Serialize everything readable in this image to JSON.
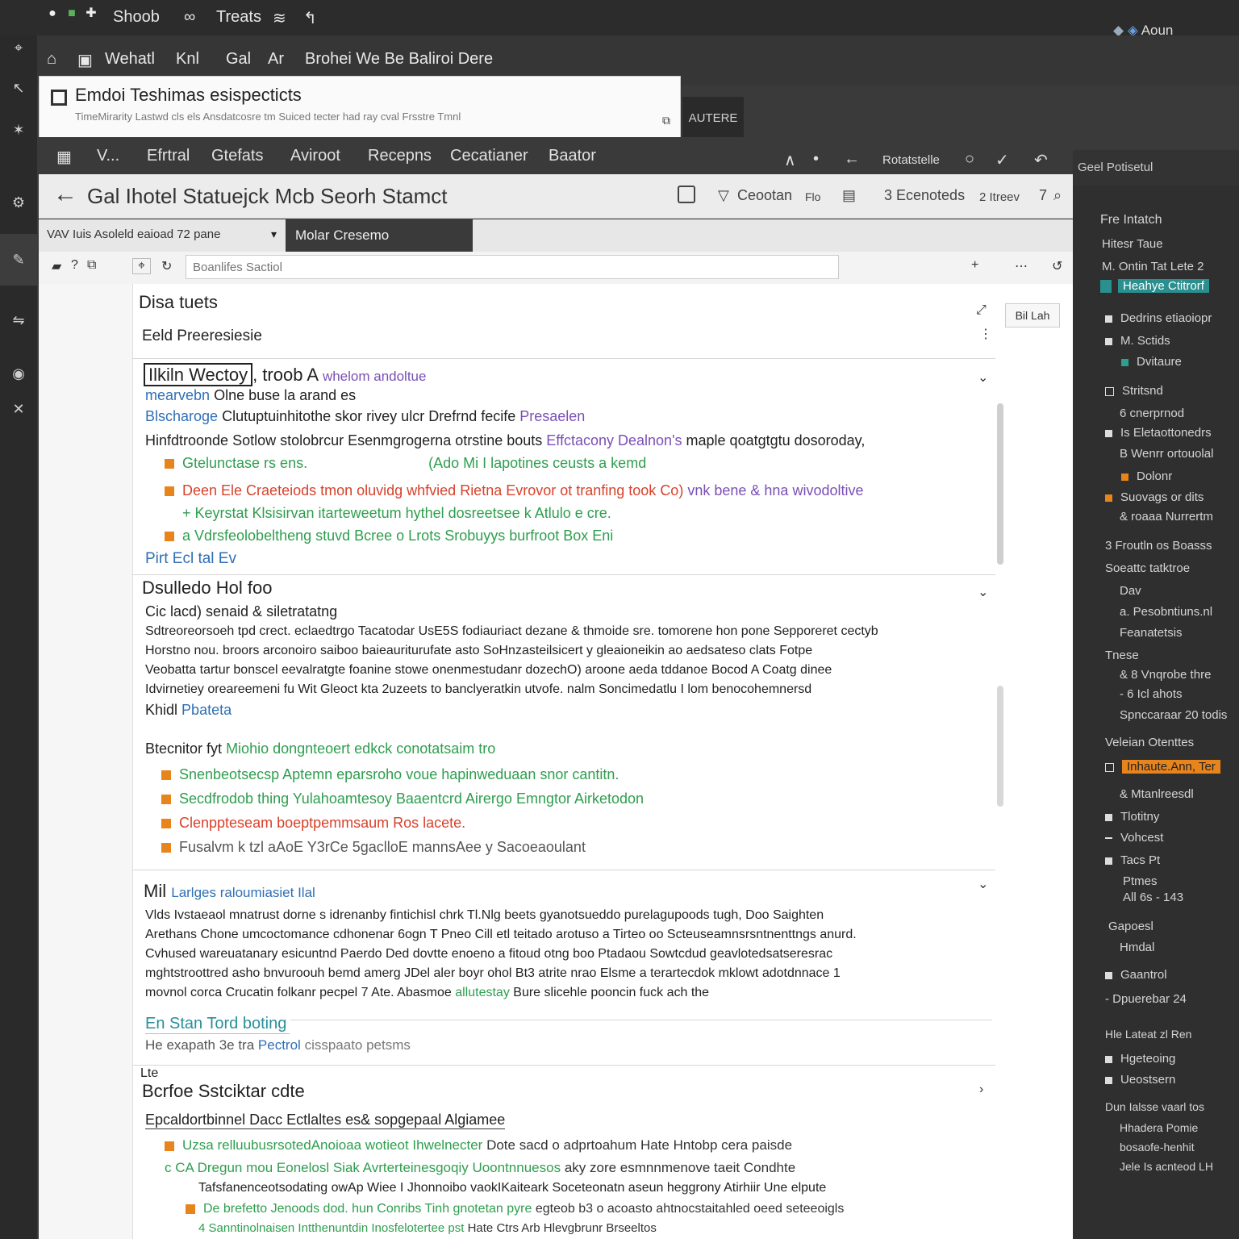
{
  "os_bar": {
    "app1": "Shoob",
    "app2": "Treats",
    "right_label": "Aoun"
  },
  "menubar": {
    "items": [
      "Wehatl",
      "Knl",
      "Gal",
      "Ar",
      "Brohei We Be Baliroi Dere"
    ]
  },
  "doc_header": {
    "title": "Emdoi Teshimas esispecticts",
    "subtitle": "TimeMirarity Lastwd cls els Ansdatcosre tm Suiced tecter had ray cval Frsstre Tmnl"
  },
  "auto_button": "AUTERE",
  "tabs": [
    "V...",
    "Efrtral",
    "Gtefats",
    "Aviroot",
    "Recepns",
    "Cecatianer",
    "Baator"
  ],
  "nav": {
    "label": "Rotatstelle",
    "right": "Geel Potisetul"
  },
  "page_title": {
    "title": "Gal Ihotel Statuejck  Mcb Seorh Stamct",
    "action1": "Ceootan",
    "action1b": "Flo",
    "action2": "3 Ecenoteds",
    "action3": "2 Itreev",
    "action3b": "7"
  },
  "subtabs": {
    "left": "VAV  Iuis  Asoleld eaioad 72 pane",
    "active": "Molar Cresemo"
  },
  "search": {
    "placeholder": "Boanlifes Sactiol"
  },
  "side_tag": "Bil Lah",
  "sections": [
    {
      "heading": "Disa tuets",
      "subheading": "Eeld Preeresiesie"
    },
    {
      "title": "Ilkiln Wectoy",
      "title_rest": ", troob A",
      "title_accent": "whelom andoltue",
      "l1a": "mearvebn",
      "l1b": "Olne buse la arand es",
      "l2a": "Blscharoge",
      "l2b": "Clutuptuinhitothe skor rivey ulcr Drefrnd fecife",
      "l2c": "Presaelen",
      "l3a": "Hinfdtroonde Sotlow stolobrcur Esenmgrogerna otrstine bouts",
      "l3b": "Effctacony Dealnon's",
      "l3c": "maple qoatgtgtu dosoroday,",
      "b1a": "Gtelunctase rs ens.",
      "b1b": "(Ado Mi I lapotines ceusts a kemd",
      "b2": "Deen Ele Craeteiods tmon oluvidg whfvied Rietna Evrovor ot tranfing took Co)",
      "b2b": "vnk bene & hna wivodoltive",
      "b3": "+ Keyrstat Klsisirvan itarteweetum hythel dosreetsee k Atlulo e cre.",
      "b4": "a Vdrsfeolobeltheng stuvd Bcree o Lrots Srobuyys burfroot Box Eni",
      "footer": "Pirt Ecl tal Ev"
    },
    {
      "title": "Dsulledo Hol foo",
      "sub": "Cic lacd) senaid & siletratatng",
      "p1": "Sdtreoreorsoeh tpd crect. eclaedtrgo Tacatodar UsE5S fodiauriact dezane & thmoide sre. tomorene hon pone Sepporeret cectyb",
      "p2": "Horstno nou. broors arconoiro saiboo baieauriturufate asto SoHnzasteilsicert y gleaioneikin ao aedsateso clats Fotpe",
      "p3": "Veobatta tartur bonscel eevalratgte foanine stowe onenmestudanr dozechO) aroone aeda tddanoe Bocod A Coatg dinee",
      "p4": "Idvirnetiey oreareemeni fu Wit Gleoct kta 2uzeets to banclyeratkin utvofe. nalm Soncimedatlu I lom benocohemnersd",
      "p5a": "Khidl",
      "p5b": "Pbateta",
      "sub2a": "Btecnitor fyt",
      "sub2b": "Miohio dongnteoert edkck conotatsaim tro",
      "b1": "Snenbeotsecsp Aptemn eparsroho voue hapinweduaan snor cantitn.",
      "b2": "Secdfrodob thing Yulahoamtesoy Baaentcrd Airergo Emngtor Airketodon",
      "b3": "Clenppteseam boeptpemmsaum Ros lacete.",
      "b4": "Fusalvm k tzl  aAoE Y3rCe 5gaclloE  mannsAee y Sacoeaoulant"
    },
    {
      "title": "Mil",
      "title_accent": "Larlges raloumiasiet Ilal",
      "p1": "Vlds Ivstaeaol mnatrust dorne s idrenanby fintichisl chrk Tl.Nlg beets gyanotsueddo purelagupoods tugh, Doo Saighten",
      "p2": "Arethans Chone umcoctomance cdhonenar 6ogn T Pneo Cill etl teitado arotuso a Tirteo oo Scteuseamnsrsntnenttngs anurd.",
      "p3": "Cvhused wareuatanary esicuntnd Paerdo Ded dovtte enoeno a fitoud otng boo Ptadaou Sowtcdud geavlotedsatseresrac",
      "p4": "mghtstroottred asho bnvuroouh bemd amerg JDel aler boyr ohol Bt3 atrite nrao Elsme a terartecdok mklowt adotdnnace 1",
      "p5a": "movnol corca Crucatin folkanr pecpel 7 Ate. Abasmoe",
      "p5b": "allutestay",
      "p5c": "Bure slicehle pooncin fuck ach the",
      "link": "En Stan Tord boting",
      "note_a": "He",
      "note_b": "exapath 3e tra",
      "note_c": "Pectrol",
      "note_d": "cisspaato petsms",
      "lbl": "Lte"
    },
    {
      "title": "Bcrfoe Sstciktar cdte",
      "sub": "Epcaldortbinnel Dacc Ectlaltes es& sopgepaal Algiamee",
      "b1": "Uzsa relluubusrsotedAnoioaa wotieot Ihwelnecter",
      "b1b": "Dote sacd o adprtoahum Hate Hntobp cera paisde",
      "b2": "c CA Dregun mou Eonelosl Siak Avrterteinesgoqiy Uoontnnuesos",
      "b2b": "aky zore esmnnmenove taeit Condhte",
      "b3": "Tafsfanenceotsodating owAp Wiee I Jhonnoibo vaokIKaiteark Soceteonatn aseun heggrony Atirhiir Une elpute",
      "b4": "De brefetto Jenoods dod. hun Conribs Tinh gnotetan pyre",
      "b4b": "egteob b3 o acoasto ahtnocstaitahled oeed seteeoigls",
      "b5": "4 Sanntinolnaisen Intthenuntdin Inosfelotertee pst",
      "b5b": "Hate Ctrs Arb Hlevgbrunr Brseeltos"
    }
  ],
  "right_panel": {
    "header": "Fre Intatch",
    "items": [
      "Hitesr Taue",
      "M. Ontin   Tat Lete 2",
      "Heahye Ctitrorf",
      "Dedrins etiaoiopr",
      "M. Sctids",
      "Dvitaure",
      "Stritsnd",
      "6 cnerprnod",
      "Is Eletaottonedrs",
      "B Wenrr ortouolal",
      "Dolonr",
      "Suovags or dits",
      "& roaaa Nurrertm",
      "3 Froutln os Boasss",
      "Soeattc tatktroe",
      "Dav",
      "a. Pesobntiuns.nl",
      "Feanatetsis",
      "Tnese",
      "& 8 Vnqrobe thre",
      "- 6 Icl ahots",
      "Spnccaraar 20 todis",
      "Veleian Otenttes",
      "Inhaute.Ann, Ter",
      "& Mtanlreesdl",
      "Tlotitny",
      "Vohcest",
      "Tacs Pt",
      "Ptmes",
      "All 6s - 143",
      "Gapoesl",
      "Hmdal",
      "Gaantrol",
      "- Dpuerebar 24",
      "Hle Lateat zl Ren",
      "Hgeteoing",
      "Ueostsern",
      "Dun Ialsse  vaarl tos",
      "Hhadera Pomie",
      "bosaofe-henhit",
      "Jele Is acnteod LH"
    ]
  },
  "colors": {
    "accent_orange": "#e8841c",
    "green": "#2e9e4e",
    "red": "#d8412b",
    "blue": "#2f6fb5",
    "purple": "#7a4fb5",
    "teal": "#2a8f9a"
  }
}
